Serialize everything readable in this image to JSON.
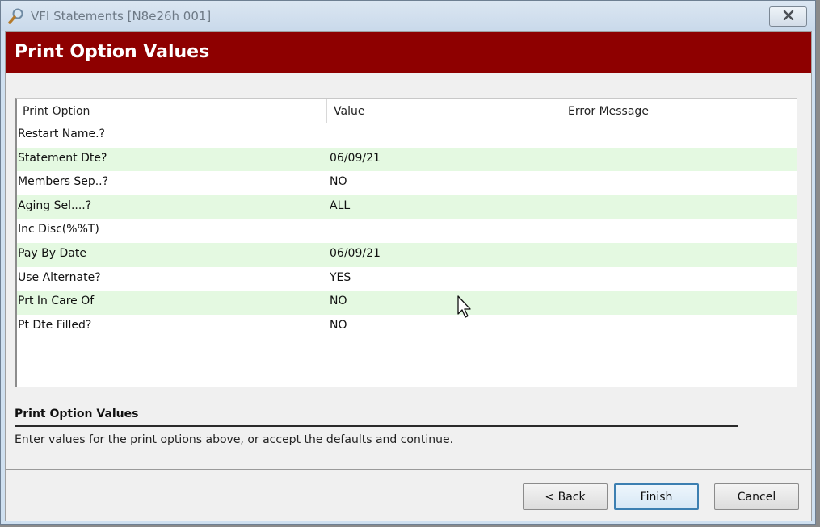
{
  "window": {
    "title": "VFI Statements [N8e26h 001]"
  },
  "banner": {
    "title": "Print Option Values"
  },
  "grid": {
    "columns": [
      "Print Option",
      "Value",
      "Error Message"
    ],
    "rows": [
      {
        "option": "Restart Name.?",
        "value": "",
        "error": ""
      },
      {
        "option": "Statement Dte?",
        "value": "06/09/21",
        "error": ""
      },
      {
        "option": "Members Sep..?",
        "value": "NO",
        "error": ""
      },
      {
        "option": "Aging Sel....?",
        "value": "ALL",
        "error": ""
      },
      {
        "option": "Inc Disc(%%T)",
        "value": "",
        "error": ""
      },
      {
        "option": "Pay By Date",
        "value": "06/09/21",
        "error": ""
      },
      {
        "option": "Use Alternate?",
        "value": "YES",
        "error": ""
      },
      {
        "option": "Prt In Care Of",
        "value": "NO",
        "error": ""
      },
      {
        "option": "Pt Dte Filled?",
        "value": "NO",
        "error": ""
      }
    ]
  },
  "description": {
    "title": "Print Option Values",
    "text": "Enter values for the print options above, or accept the defaults and continue."
  },
  "buttons": {
    "back": "< Back",
    "finish": "Finish",
    "cancel": "Cancel"
  },
  "icons": {
    "app": "magnifier-icon",
    "close": "close-icon",
    "cursor": "mouse-pointer-icon"
  },
  "colors": {
    "banner": "#8e0000",
    "row_alt": "#e4f9e1",
    "finish_border": "#3c7fb1"
  }
}
